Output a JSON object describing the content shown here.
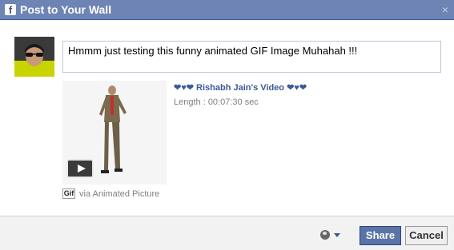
{
  "dialog": {
    "title": "Post to Your Wall",
    "logo_letter": "f",
    "close_glyph": "×"
  },
  "composer": {
    "message": "Hmmm just testing this funny animated GIF Image Muhahah !!!"
  },
  "attachment": {
    "title": "❤♥❤ Rishabh Jain's Video ❤♥❤",
    "length": "Length : 00:07:30 sec",
    "source_icon": "Gif",
    "via": "via Animated Picture"
  },
  "footer": {
    "privacy_icon": "globe-icon",
    "share_label": "Share",
    "cancel_label": "Cancel"
  },
  "colors": {
    "header_bg": "#6d84b4",
    "link": "#3b5998",
    "share_bg": "#5b74a8"
  }
}
